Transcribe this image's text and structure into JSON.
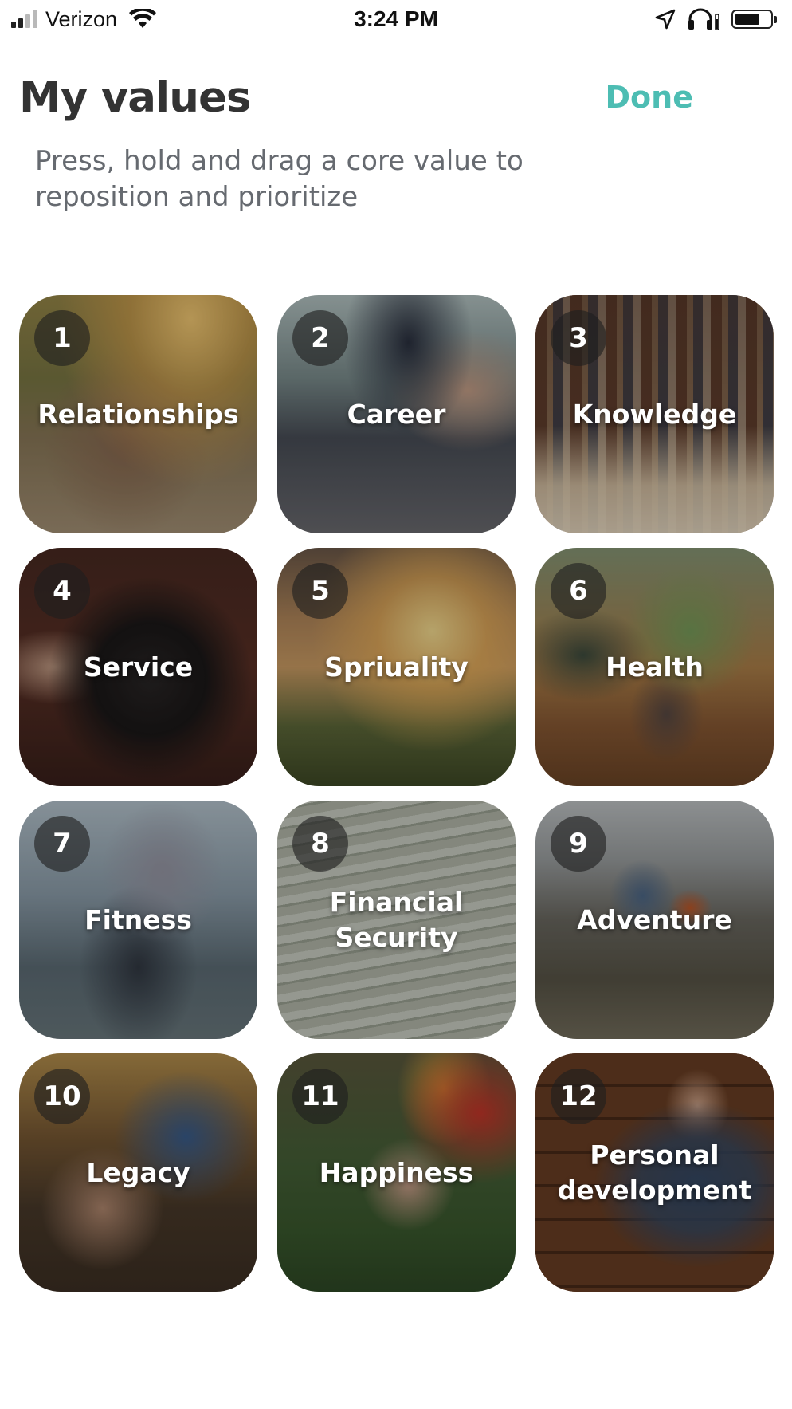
{
  "status_bar": {
    "carrier": "Verizon",
    "time": "3:24 PM",
    "icons": [
      "signal-icon",
      "wifi-icon",
      "location-arrow-icon",
      "headphones-icon",
      "battery-icon"
    ]
  },
  "header": {
    "title": "My values",
    "done_label": "Done"
  },
  "instructions": "Press, hold and drag a core value to reposition and prioritize",
  "colors": {
    "accent": "#4dbdb3",
    "title": "#333333",
    "instructions": "#666a70"
  },
  "values": [
    {
      "rank": "1",
      "label": "Relationships"
    },
    {
      "rank": "2",
      "label": "Career"
    },
    {
      "rank": "3",
      "label": "Knowledge"
    },
    {
      "rank": "4",
      "label": "Service"
    },
    {
      "rank": "5",
      "label": "Spriuality"
    },
    {
      "rank": "6",
      "label": "Health"
    },
    {
      "rank": "7",
      "label": "Fitness"
    },
    {
      "rank": "8",
      "label": "Financial\nSecurity"
    },
    {
      "rank": "9",
      "label": "Adventure"
    },
    {
      "rank": "10",
      "label": "Legacy"
    },
    {
      "rank": "11",
      "label": "Happiness"
    },
    {
      "rank": "12",
      "label": "Personal\ndevelopment"
    }
  ]
}
